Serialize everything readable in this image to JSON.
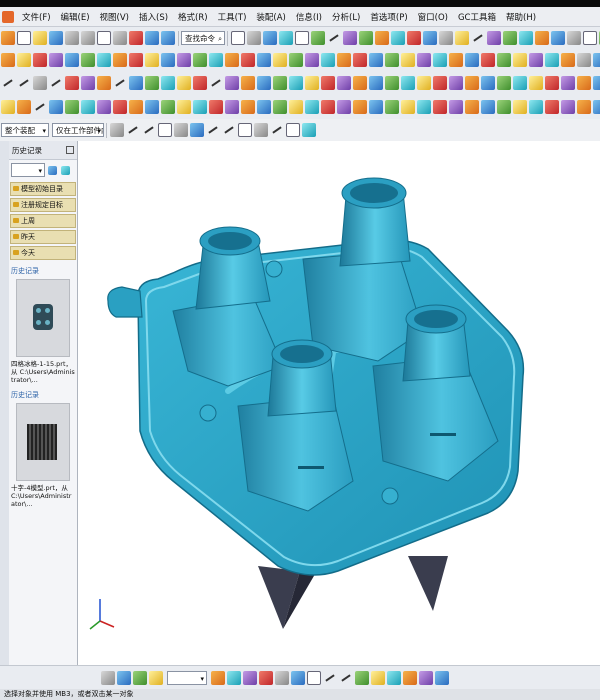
{
  "menu": {
    "items": [
      "文件(F)",
      "编辑(E)",
      "视图(V)",
      "插入(S)",
      "格式(R)",
      "工具(T)",
      "装配(A)",
      "信息(I)",
      "分析(L)",
      "首选项(P)",
      "窗口(O)",
      "GC工具箱",
      "帮助(H)"
    ]
  },
  "toolbar": {
    "command_search_placeholder": "查找命令",
    "selection_filter": "整个装配",
    "work_layer_scope": "仅在工作部件内"
  },
  "resource_panel": {
    "title": "历史记录",
    "categories": [
      "模型初始目录",
      "注册规定目标",
      "上周",
      "昨天",
      "今天"
    ],
    "section_label_1": "历史记录",
    "file_1": "四格冰格-1-15.prt，从 C:\\Users\\Administrator\\...",
    "section_label_2": "历史记录",
    "file_2": "十字-4模型.prt，从 C:\\Users\\Administrator\\..."
  },
  "statusbar": {
    "text": "选择对象并使用 MB3，或者双击某一对象"
  },
  "colors": {
    "model_body": "#2aa6c8",
    "model_dark": "#1a6f8c",
    "model_light": "#55c7e2",
    "legs": "#3a3d4e"
  }
}
